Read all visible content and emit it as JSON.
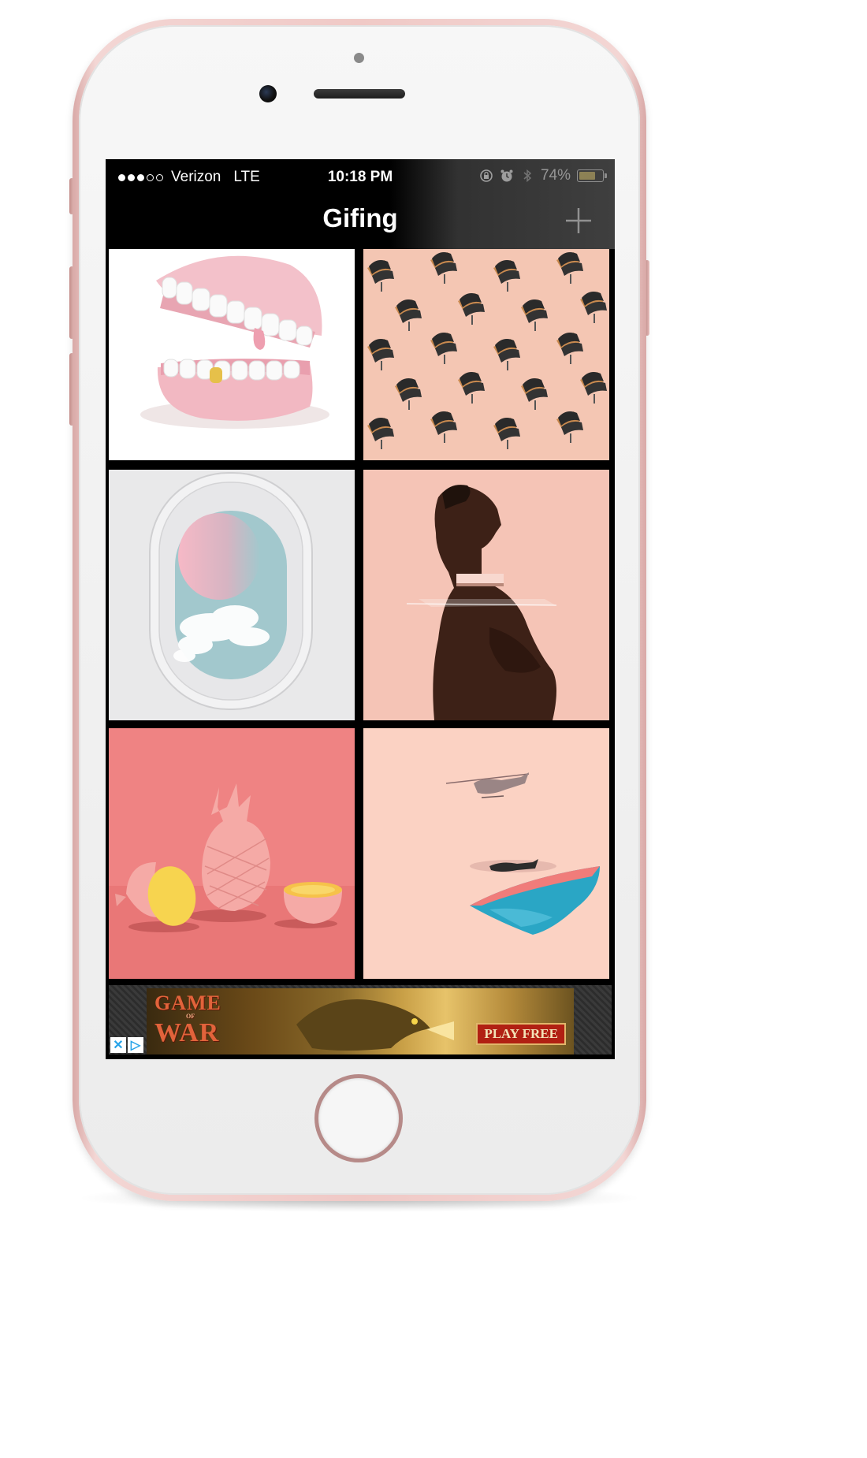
{
  "status_bar": {
    "signal_full": 3,
    "signal_total": 5,
    "carrier": "Verizon",
    "network": "LTE",
    "time": "10:18 PM",
    "battery_percent": "74%",
    "battery_level": 0.74,
    "icons": [
      "rotation-lock-icon",
      "alarm-icon",
      "bluetooth-icon",
      "battery-icon"
    ]
  },
  "nav": {
    "title": "Gifing",
    "add_icon": "plus-icon"
  },
  "grid": {
    "tiles": [
      {
        "name": "teeth",
        "subject": "pink-teeth-gold-tooth"
      },
      {
        "name": "chairs",
        "subject": "lounge-chairs-pattern"
      },
      {
        "name": "airplane-window",
        "subject": "airplane-window-sunset"
      },
      {
        "name": "man-profile",
        "subject": "sliced-man-profile"
      },
      {
        "name": "pineapples",
        "subject": "pink-pineapples"
      },
      {
        "name": "helicopters",
        "subject": "helicopters-pool"
      }
    ]
  },
  "ad": {
    "title_line1": "GAME",
    "title_line2": "OF",
    "title_line3": "WAR",
    "cta": "PLAY FREE",
    "close_icon": "close-icon",
    "adchoices_icon": "adchoices-icon"
  },
  "colors": {
    "phone_rose": "#f0c9c6",
    "battery_fill": "#f5d24a",
    "screen_bg": "#000000"
  }
}
